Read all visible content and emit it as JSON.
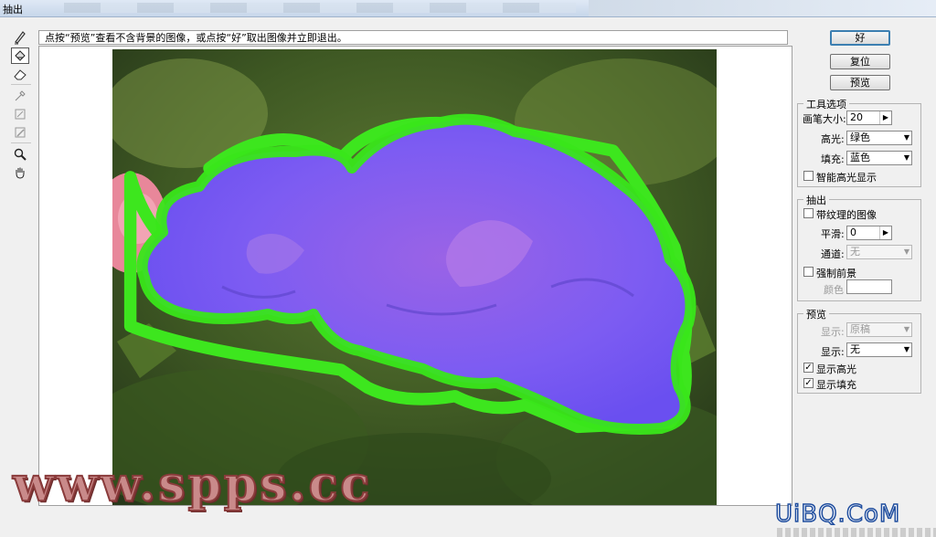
{
  "window": {
    "title": "抽出"
  },
  "hint_text": "点按“预览”查看不含背景的图像，或点按“好”取出图像并立即退出。",
  "toolbar": {
    "tools": [
      {
        "name": "edge-highlighter",
        "icon": "highlighter-icon"
      },
      {
        "name": "fill",
        "icon": "fill-bucket-icon",
        "active": true
      },
      {
        "name": "eraser",
        "icon": "eraser-icon"
      },
      {
        "name": "eyedropper",
        "icon": "eyedropper-icon"
      },
      {
        "name": "cleanup",
        "icon": "cleanup-icon"
      },
      {
        "name": "edge-touchup",
        "icon": "edge-touchup-icon"
      },
      {
        "name": "zoom",
        "icon": "zoom-icon"
      },
      {
        "name": "hand",
        "icon": "hand-icon"
      }
    ]
  },
  "buttons": {
    "ok": "好",
    "reset": "复位",
    "preview": "预览"
  },
  "tool_options": {
    "title": "工具选项",
    "brush_size_label": "画笔大小:",
    "brush_size_value": "20",
    "highlight_label": "高光:",
    "highlight_value": "绿色",
    "fill_label": "填充:",
    "fill_value": "蓝色",
    "smart_highlight_label": "智能高光显示",
    "smart_highlight_checked": false
  },
  "extract": {
    "title": "抽出",
    "textured_label": "带纹理的图像",
    "textured_checked": false,
    "smooth_label": "平滑:",
    "smooth_value": "0",
    "channel_label": "通道:",
    "channel_value": "无",
    "force_fg_label": "强制前景",
    "force_fg_checked": false,
    "color_label": "颜色"
  },
  "preview": {
    "title": "预览",
    "show_label": "显示:",
    "show_value": "原稿",
    "display_label": "显示:",
    "display_value": "无",
    "show_highlight_label": "显示高光",
    "show_highlight_checked": true,
    "show_fill_label": "显示填充",
    "show_fill_checked": true
  },
  "watermarks": {
    "left": "www.spps.cc",
    "right": "UiBQ.CoM"
  },
  "colors": {
    "highlight": "#39e61a",
    "fill": "#7a5cff",
    "foliage": "#4b6a2a"
  }
}
